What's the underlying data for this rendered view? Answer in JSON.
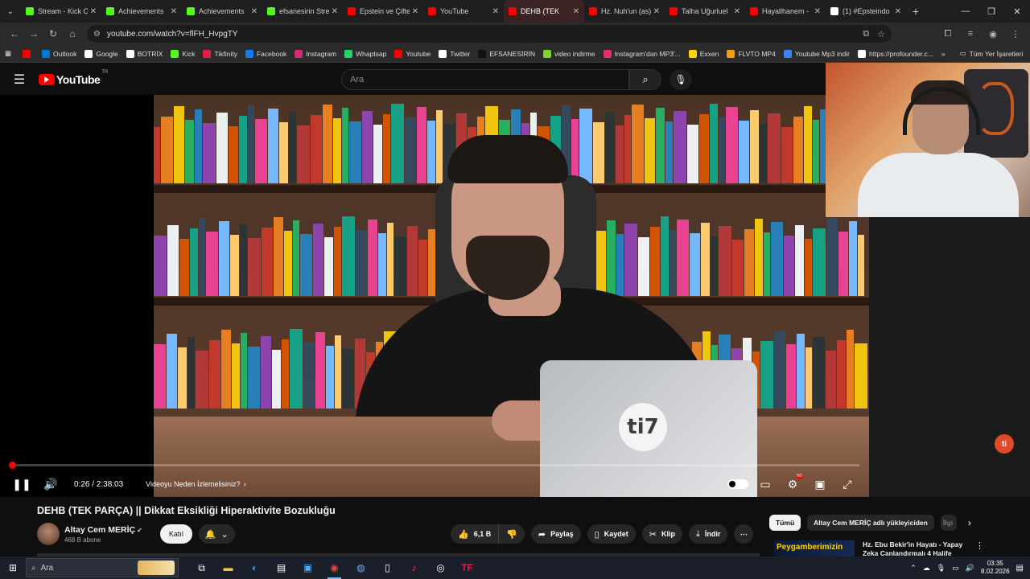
{
  "browser": {
    "tabs": [
      {
        "label": "Stream - Kick C",
        "icon": "kick-icon",
        "color": "#53fc18"
      },
      {
        "label": "Achievements",
        "icon": "kick-icon",
        "color": "#53fc18"
      },
      {
        "label": "Achievements",
        "icon": "kick-icon",
        "color": "#53fc18"
      },
      {
        "label": "efsanesirin Stre",
        "icon": "kick-icon",
        "color": "#53fc18"
      },
      {
        "label": "Epstein ve Çifte",
        "icon": "youtube-icon",
        "color": "#ff0000"
      },
      {
        "label": "YouTube",
        "icon": "youtube-icon",
        "color": "#ff0000"
      },
      {
        "label": "DEHB (TEK",
        "icon": "youtube-icon",
        "color": "#ff0000",
        "active": true
      },
      {
        "label": "Hz. Nuh'un (as)",
        "icon": "youtube-icon",
        "color": "#ff0000"
      },
      {
        "label": "Talha Uğurluel",
        "icon": "youtube-icon",
        "color": "#ff0000"
      },
      {
        "label": "Hayallhanem -",
        "icon": "youtube-icon",
        "color": "#ff0000"
      },
      {
        "label": "(1) #Epsteindo",
        "icon": "x-icon",
        "color": "#ffffff"
      }
    ],
    "url": "youtube.com/watch?v=flFH_HvpgTY",
    "bookmarks": [
      {
        "label": "",
        "color": "#ff0000",
        "icon": "youtube-icon"
      },
      {
        "label": "Outlook",
        "color": "#0078d4",
        "icon": "outlook-icon"
      },
      {
        "label": "Google",
        "color": "#ffffff",
        "icon": "google-icon"
      },
      {
        "label": "BOTRİX",
        "color": "#ffffff",
        "icon": "botrix-icon"
      },
      {
        "label": "Kick",
        "color": "#53fc18",
        "icon": "kick-icon"
      },
      {
        "label": "Tikfinity",
        "color": "#e11d48",
        "icon": "tikfinity-icon"
      },
      {
        "label": "Facebook",
        "color": "#1877f2",
        "icon": "facebook-icon"
      },
      {
        "label": "Instagram",
        "color": "#d62976",
        "icon": "instagram-icon"
      },
      {
        "label": "Whaptsap",
        "color": "#25d366",
        "icon": "whatsapp-icon"
      },
      {
        "label": "Youtube",
        "color": "#ff0000",
        "icon": "youtube-icon"
      },
      {
        "label": "Twitter",
        "color": "#ffffff",
        "icon": "x-icon"
      },
      {
        "label": "EFSANESİRİN",
        "color": "#111111",
        "icon": "tiktok-icon"
      },
      {
        "label": "video indirme",
        "color": "#7cd32a",
        "icon": "download-icon"
      },
      {
        "label": "Instagram'dan MP3'...",
        "color": "#e1306c",
        "icon": "instagram-icon"
      },
      {
        "label": "Exxen",
        "color": "#ffd400",
        "icon": "exxen-icon"
      },
      {
        "label": "FLVTO MP4",
        "color": "#f39c12",
        "icon": "flvto-icon"
      },
      {
        "label": "Youtube Mp3 indir",
        "color": "#3b82f6",
        "icon": "youtube-mp3-icon"
      },
      {
        "label": "https://profounder.c...",
        "color": "#ffffff",
        "icon": "profounder-icon"
      }
    ],
    "bookmarks_all": "Tüm Yer İşaretleri"
  },
  "youtube": {
    "logo": "YouTube",
    "country": "TR",
    "search_placeholder": "Ara",
    "player": {
      "current_time": "0:26",
      "duration": "2:38:03",
      "time_display": "0:26 / 2:38:03",
      "progress": 0.0027,
      "why_watch": "Videoyu Neden İzlemelisiniz?",
      "hd_badge": "HD",
      "watermark": "ti"
    },
    "video": {
      "title": "DEHB (TEK PARÇA) || Dikkat Eksikliği Hiperaktivite Bozukluğu",
      "channel": "Altay Cem MERİÇ",
      "subscribers": "468 B abone",
      "join": "Katıl",
      "laptop_logo": "ti7"
    },
    "actions": {
      "likes": "6,1 B",
      "share": "Paylaş",
      "save": "Kaydet",
      "clip": "Klip",
      "download": "İndir"
    },
    "chips": [
      "Tümü",
      "Altay Cem MERİÇ adlı yükleyiciden",
      "İlgi"
    ],
    "recommended": {
      "thumb_text": "Peygamberimizin",
      "title": "Hz. Ebu Bekir'in Hayatı - Yapay Zeka Canlandırmalı 4 Halife"
    }
  },
  "taskbar": {
    "search": "Ara",
    "time": "03:35",
    "date": "8.02.2026"
  }
}
